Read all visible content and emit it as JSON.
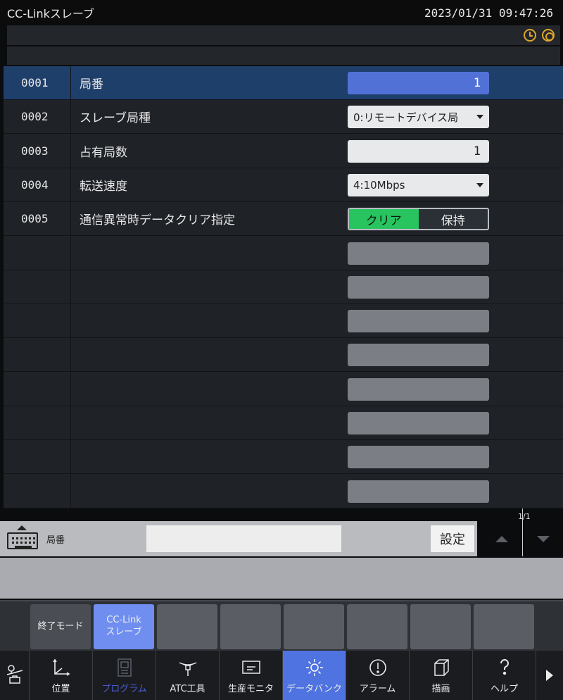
{
  "window": {
    "title": "CC-Linkスレーブ",
    "datetime": "2023/01/31 09:47:26"
  },
  "status_icons": [
    "clock-icon",
    "sync-icon"
  ],
  "rows": [
    {
      "no": "0001",
      "name": "局番",
      "type": "number",
      "value": "1",
      "active": true
    },
    {
      "no": "0002",
      "name": "スレーブ局種",
      "type": "dropdown",
      "value": "0:リモートデバイス局"
    },
    {
      "no": "0003",
      "name": "占有局数",
      "type": "number",
      "value": "1"
    },
    {
      "no": "0004",
      "name": "転送速度",
      "type": "dropdown",
      "value": "4:10Mbps"
    },
    {
      "no": "0005",
      "name": "通信異常時データクリア指定",
      "type": "toggle",
      "options": [
        "クリア",
        "保持"
      ],
      "selected": 0
    }
  ],
  "empty_rows": 8,
  "input": {
    "label": "局番",
    "value": "",
    "set_label": "設定",
    "page": "1/1"
  },
  "function_keys": [
    {
      "label": "終了モード",
      "state": "normal"
    },
    {
      "label": "CC-Link\nスレーブ",
      "state": "selected"
    },
    {
      "label": "",
      "state": "empty"
    },
    {
      "label": "",
      "state": "empty"
    },
    {
      "label": "",
      "state": "empty"
    },
    {
      "label": "",
      "state": "empty"
    },
    {
      "label": "",
      "state": "empty"
    },
    {
      "label": "",
      "state": "empty"
    }
  ],
  "nav": [
    {
      "label": "",
      "icon": "lamp-toolbox-icon"
    },
    {
      "label": "位置",
      "icon": "axis-icon"
    },
    {
      "label": "プログラム",
      "icon": "program-icon",
      "disabled": true
    },
    {
      "label": "ATC工具",
      "icon": "tool-icon"
    },
    {
      "label": "生産モニタ",
      "icon": "monitor-icon"
    },
    {
      "label": "データバンク",
      "icon": "gear-icon",
      "selected": true
    },
    {
      "label": "アラーム",
      "icon": "alarm-icon"
    },
    {
      "label": "描画",
      "icon": "cube-icon"
    },
    {
      "label": "ヘルプ",
      "icon": "help-icon"
    }
  ],
  "colors": {
    "selected_row": "#1f3f6b",
    "active_field": "#5271d6",
    "toggle_on": "#27c45f",
    "nav_selected": "#4f73e0",
    "accent_icon": "#e0a52b"
  }
}
